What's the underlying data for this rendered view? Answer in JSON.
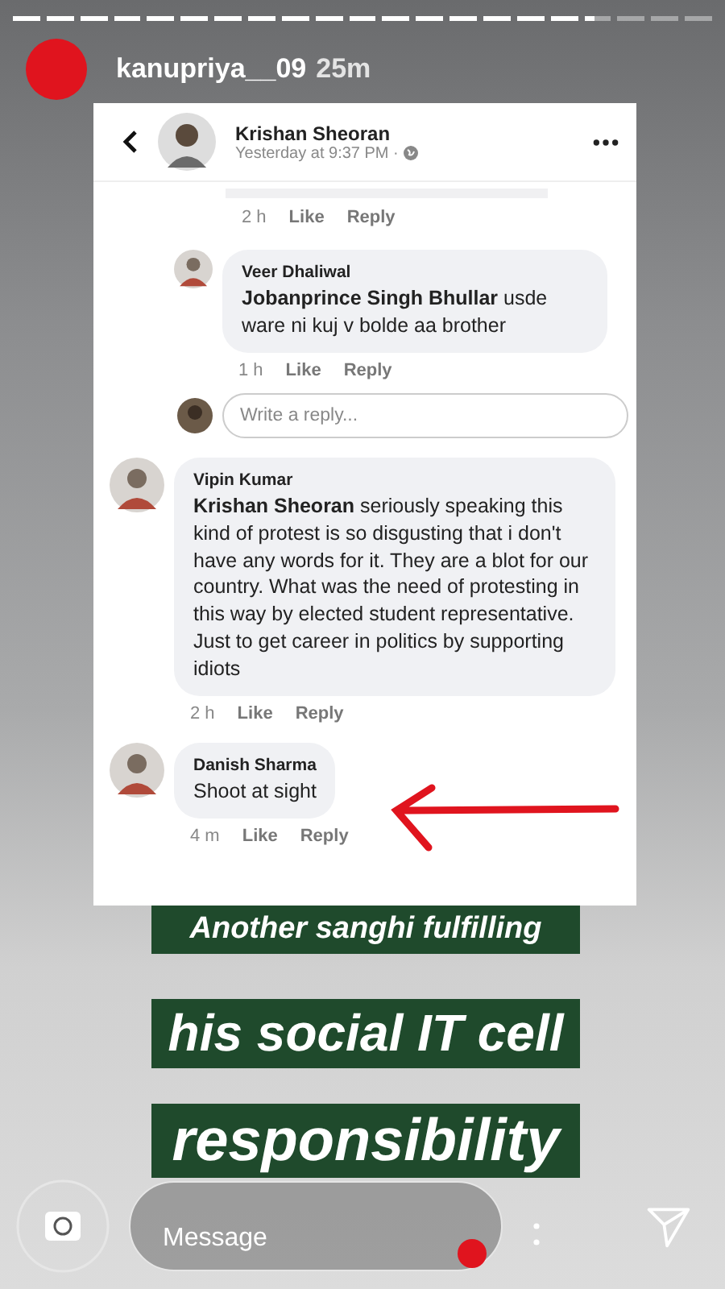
{
  "story": {
    "progress": [
      {
        "level": 1
      },
      {
        "level": 1
      },
      {
        "level": 1
      },
      {
        "level": 1
      },
      {
        "level": 1
      },
      {
        "level": 1
      },
      {
        "level": 1
      },
      {
        "level": 1
      },
      {
        "level": 1
      },
      {
        "level": 1
      },
      {
        "level": 1
      },
      {
        "level": 1
      },
      {
        "level": 1
      },
      {
        "level": 1
      },
      {
        "level": 1
      },
      {
        "level": 1
      },
      {
        "level": 1
      },
      {
        "level": 0.4
      },
      {
        "level": 0
      },
      {
        "level": 0
      },
      {
        "level": 0
      }
    ],
    "username": "kanupriya__09",
    "time": "25m"
  },
  "post": {
    "author": "Krishan Sheoran",
    "time": "Yesterday at 9:37 PM ·"
  },
  "comments": [
    {
      "kind": "footer",
      "time": "2 h",
      "like": "Like",
      "reply": "Reply"
    },
    {
      "kind": "reply",
      "name": "Veer Dhaliwal",
      "text": "**Jobanprince Singh Bhullar** usde ware ni kuj v bolde aa brother",
      "time": "1 h",
      "like": "Like",
      "reply": "Reply"
    },
    {
      "kind": "write",
      "placeholder": "Write a reply..."
    },
    {
      "kind": "comment",
      "name": "Vipin Kumar",
      "text": "**Krishan Sheoran** seriously speaking this kind of protest is so disgusting that i don't have any words for it. They are a blot for our country. What was the need of protesting in this way by elected student representative. Just to get career in politics by supporting idiots",
      "time": "2 h",
      "like": "Like",
      "reply": "Reply"
    },
    {
      "kind": "comment",
      "name": "Danish Sharma",
      "text": "Shoot at sight",
      "time": "4 m",
      "like": "Like",
      "reply": "Reply"
    }
  ],
  "captions": [
    "Another sanghi fulfilling",
    "his social IT cell",
    "responsibility"
  ],
  "message": {
    "placeholder": "Message"
  }
}
